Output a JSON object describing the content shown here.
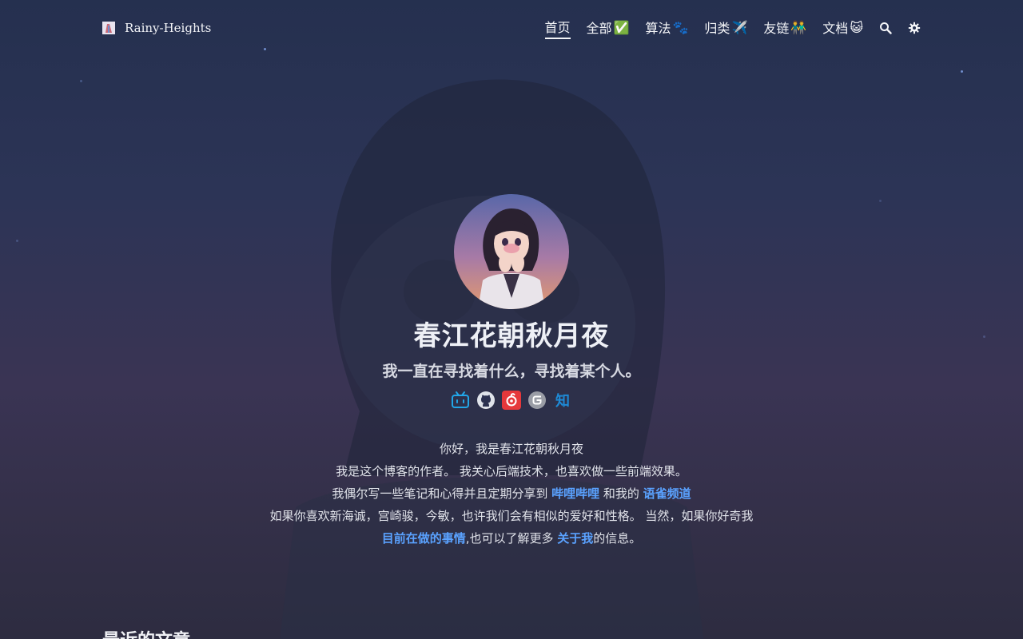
{
  "nav": {
    "brand": "Rainy-Heights",
    "links": [
      {
        "label": "首页",
        "emoji": ""
      },
      {
        "label": "全部",
        "emoji": "✅"
      },
      {
        "label": "算法",
        "emoji": "🐾"
      },
      {
        "label": "归类",
        "emoji": "✈️"
      },
      {
        "label": "友链",
        "emoji": "👬"
      },
      {
        "label": "文档",
        "emoji": "😺"
      }
    ],
    "search_icon": "search-icon",
    "theme_icon": "gear-icon"
  },
  "hero": {
    "title": "春江花朝秋月夜",
    "subtitle": "我一直在寻找着什么，寻找着某个人。",
    "socials": [
      "bilibili-icon",
      "github-icon",
      "netease-music-icon",
      "gitee-icon",
      "zhihu-icon"
    ],
    "zhihu_text": "知"
  },
  "intro": {
    "line1": "你好，我是春江花朝秋月夜",
    "line2": "我是这个博客的作者。 我关心后端技术，也喜欢做一些前端效果。",
    "line3_prefix": "我偶尔写一些笔记和心得并且定期分享到 ",
    "line3_link1": "哔哩哔哩",
    "line3_mid": " 和我的 ",
    "line3_link2": "语雀频道",
    "line4": "如果你喜欢新海诚，宫崎骏，今敏，也许我们会有相似的爱好和性格。 当然，如果你好奇我",
    "line5_link1": "目前在做的事情",
    "line5_mid": ",也可以了解更多 ",
    "line5_link2": "关于我",
    "line5_suffix": "的信息。"
  },
  "recent_heading": "最近的文章",
  "colors": {
    "link": "#5aa2ff",
    "background_top": "#25304f",
    "background_bottom": "#2d2c40"
  }
}
